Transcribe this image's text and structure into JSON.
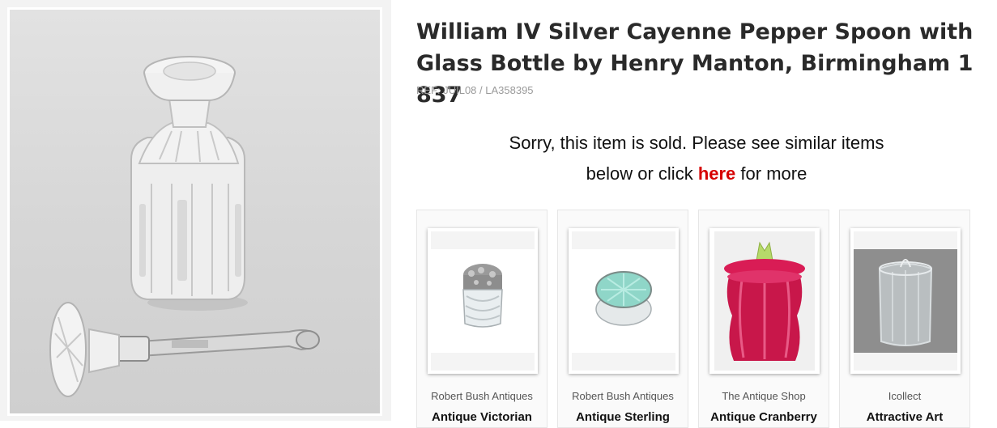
{
  "product": {
    "title": "William IV Silver Cayenne Pepper Spoon with Glass Bottle by Henry Manton, Birmingham 1837",
    "ref": "REF: JUIL08 / LA358395"
  },
  "sold_message": {
    "before": "Sorry, this item is sold. Please see similar items below or click ",
    "link": "here",
    "after": " for more"
  },
  "similar_items": [
    {
      "dealer": "Robert Bush Antiques",
      "name": "Antique Victorian"
    },
    {
      "dealer": "Robert Bush Antiques",
      "name": "Antique Sterling"
    },
    {
      "dealer": "The Antique Shop",
      "name": "Antique Cranberry"
    },
    {
      "dealer": "Icollect",
      "name": "Attractive Art"
    }
  ],
  "colors": {
    "link": "#d60000",
    "cranberry": "#c8174a"
  }
}
